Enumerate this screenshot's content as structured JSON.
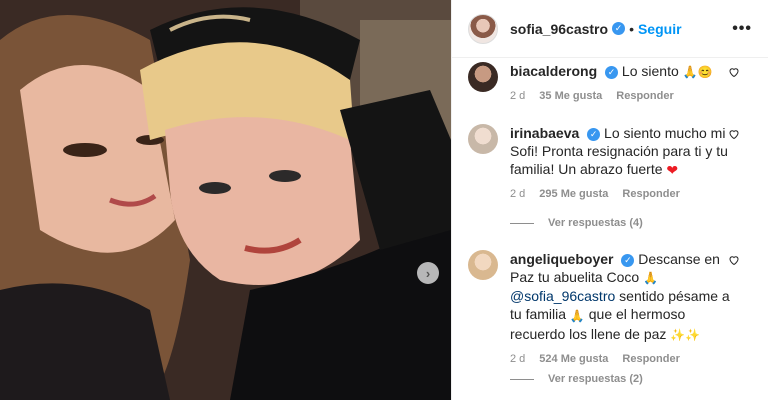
{
  "header": {
    "username": "sofia_96castro",
    "separator": "•",
    "follow_label": "Seguir",
    "more_label": "•••"
  },
  "comments": [
    {
      "username": "biacalderong",
      "message": "Lo siento",
      "emojis": "🙏😊",
      "age": "2 d",
      "likes": "35 Me gusta",
      "reply_label": "Responder"
    },
    {
      "username": "irinabaeva",
      "message": "Lo siento mucho mi Sofi! Pronta resignación para ti y tu familia! Un abrazo fuerte",
      "emojis": "❤",
      "age": "2 d",
      "likes": "295 Me gusta",
      "reply_label": "Responder",
      "view_replies": "Ver respuestas (4)"
    },
    {
      "username": "angeliqueboyer",
      "message_part1": "Descanse en Paz tu abuelita Coco",
      "emoji1": "🙏",
      "mention": "@sofia_96castro",
      "message_part2": "sentido pésame a tu familia",
      "emoji2": "🙏",
      "message_part3": "que el hermoso recuerdo los llene de paz",
      "emoji3": "✨✨",
      "age": "2 d",
      "likes": "524 Me gusta",
      "reply_label": "Responder",
      "view_replies": "Ver respuestas (2)"
    }
  ],
  "carousel": {
    "next_icon": "›"
  },
  "colors": {
    "accent": "#0095f6",
    "verified": "#3897f0",
    "muted": "#8e8e8e",
    "text": "#262626"
  }
}
